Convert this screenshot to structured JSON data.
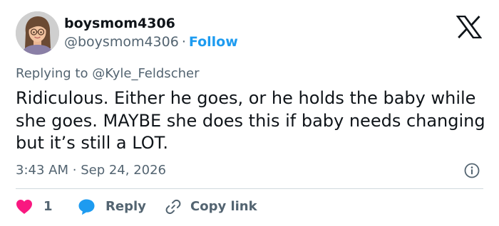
{
  "author": {
    "display_name": "boysmom4306",
    "handle": "@boysmom4306",
    "separator": "·",
    "follow_label": "Follow",
    "avatar_icon": "memoji-avatar-icon"
  },
  "platform_logo": "x-logo-icon",
  "reply_context": {
    "prefix": "Replying to",
    "mention": "@Kyle_Feldscher"
  },
  "tweet": {
    "text": "Ridiculous. Either he goes, or he holds the baby while she goes. MAYBE she does this if baby needs changing but it’s still a LOT.",
    "time": "3:43 AM",
    "separator": "·",
    "date": "Sep 24, 2026",
    "info_icon": "info-icon"
  },
  "actions": {
    "like_count": "1",
    "reply_label": "Reply",
    "copy_label": "Copy link"
  },
  "colors": {
    "accent": "#1d9bf0",
    "like": "#f91880",
    "text": "#0f1419",
    "secondary": "#536471",
    "divider": "#cfd9de"
  }
}
